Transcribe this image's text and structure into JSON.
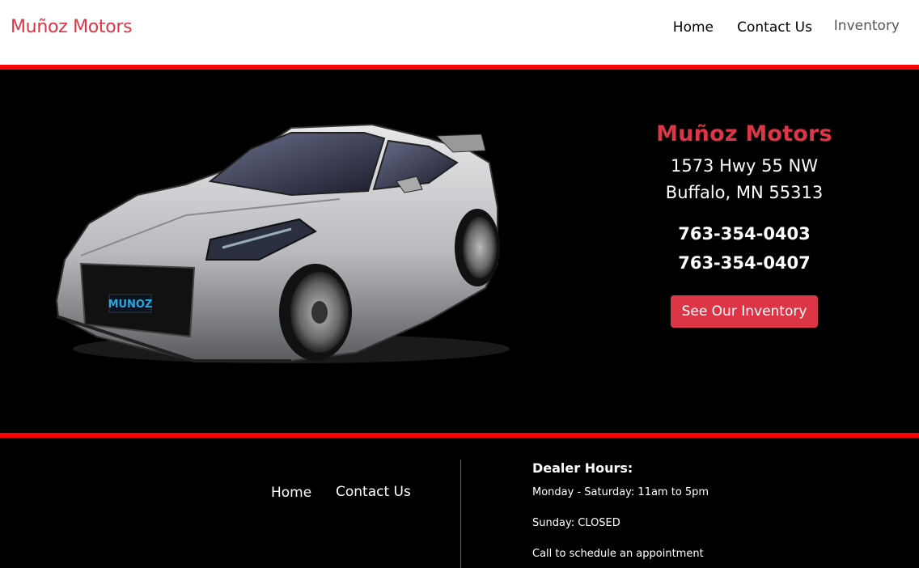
{
  "navbar": {
    "brand": "Muñoz Motors",
    "links": [
      "Home",
      "Contact Us",
      "Inventory"
    ]
  },
  "hero": {
    "title": "Muñoz Motors",
    "address_line1": "1573 Hwy 55 NW",
    "address_line2": "Buffalo, MN 55313",
    "phone1": "763-354-0403",
    "phone2": "763-354-0407",
    "cta": "See Our Inventory",
    "plate": "MUNOZ"
  },
  "footer": {
    "links": [
      "Home",
      "Contact Us"
    ],
    "hours_title": "Dealer Hours:",
    "hours": [
      "Monday - Saturday: 11am to 5pm",
      "Sunday: CLOSED",
      "Call to schedule an appointment"
    ]
  },
  "colors": {
    "accent": "#dc3545",
    "stripe": "#ff0000",
    "background": "#000000"
  }
}
